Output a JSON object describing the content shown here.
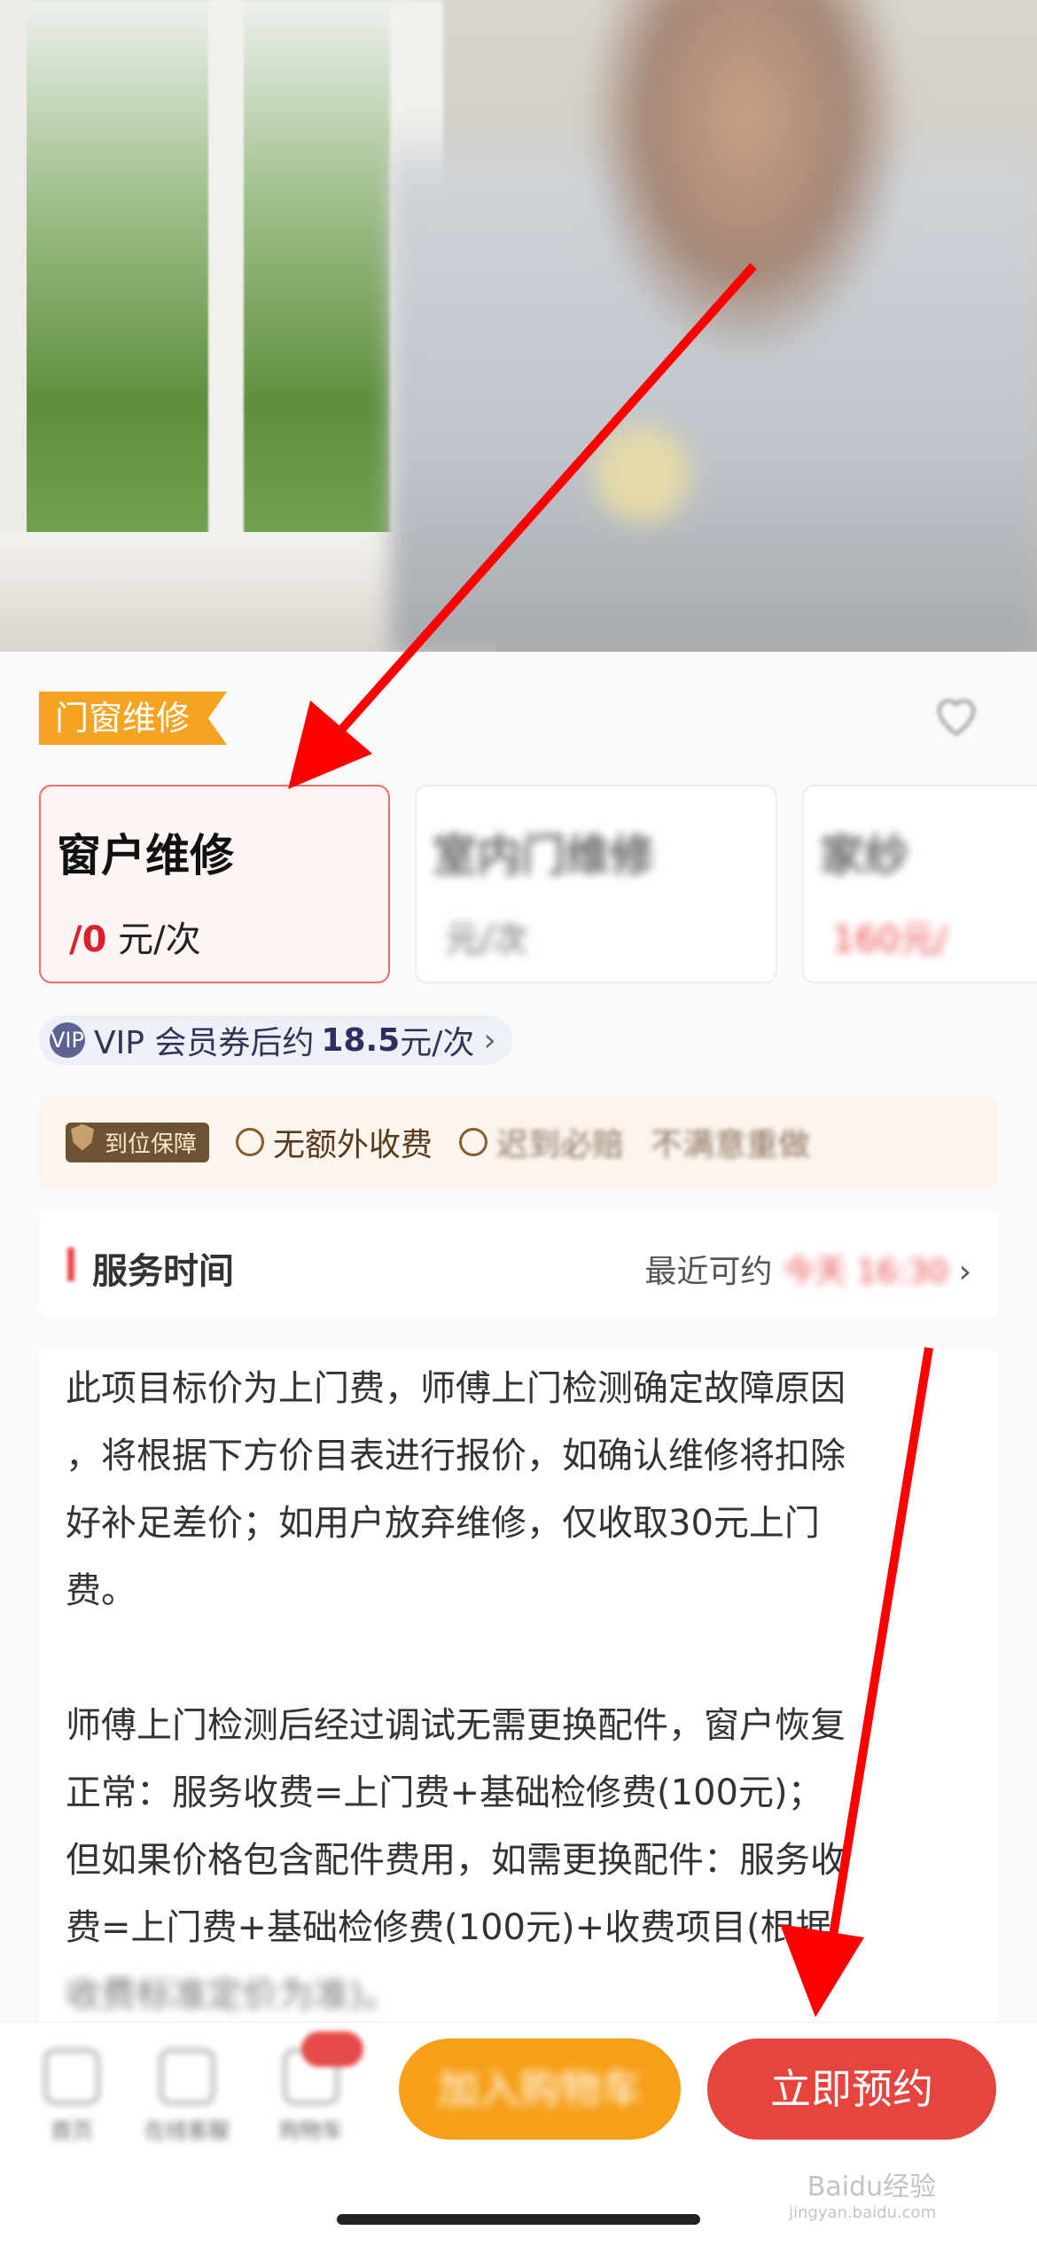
{
  "hero": {
    "blur_texts": [
      "",
      ""
    ]
  },
  "category_tag": "门窗维修",
  "services": [
    {
      "name": "窗户维修",
      "price_num": "/0",
      "price_unit": "元/次",
      "selected": true
    },
    {
      "name": "室内门维修",
      "price_num": "",
      "price_unit": "元/次"
    },
    {
      "name": "家纱",
      "price_num": "160",
      "price_unit": "元/"
    }
  ],
  "vip": {
    "crown_label": "VIP",
    "prefix": "VIP 会员券后约",
    "price": "18.5",
    "unit": "元/次",
    "chevron": "›"
  },
  "guarantees": {
    "badge": "到位保障",
    "no_extra": "无额外收费",
    "late": "迟到必赔",
    "more": "不满意重做"
  },
  "service_time": {
    "label": "服务时间",
    "right_prefix": "最近可约",
    "right_value": "今天 16:30",
    "chevron": "›"
  },
  "description": {
    "para1": [
      "此项目标价为上门费，师傅上门检测确定故障原因",
      "，将根据下方价目表进行报价，如确认维修将扣除",
      "好补足差价；如用户放弃维修，仅收取30元上门",
      "费。"
    ],
    "para2": [
      "师傅上门检测后经过调试无需更换配件，窗户恢复",
      "正常：服务收费=上门费+基础检修费(100元)；",
      "但如果价格包含配件费用，如需更换配件：服务收",
      "费=上门费+基础检修费(100元)+收费项目(根据",
      "收费标准定价为准)。"
    ]
  },
  "bottom_bar": {
    "nav": [
      {
        "label": "首页"
      },
      {
        "label": "在线客服"
      },
      {
        "label": "购物车"
      }
    ],
    "cart_label": "加入购物车",
    "book_label": "立即预约",
    "watermark": "Baidu经验",
    "watermark_sub": "jingyan.baidu.com"
  },
  "colors": {
    "accent": "#e5443f",
    "tag": "#f5a321",
    "cart": "#f6a019",
    "arrow": "#ff0000"
  }
}
